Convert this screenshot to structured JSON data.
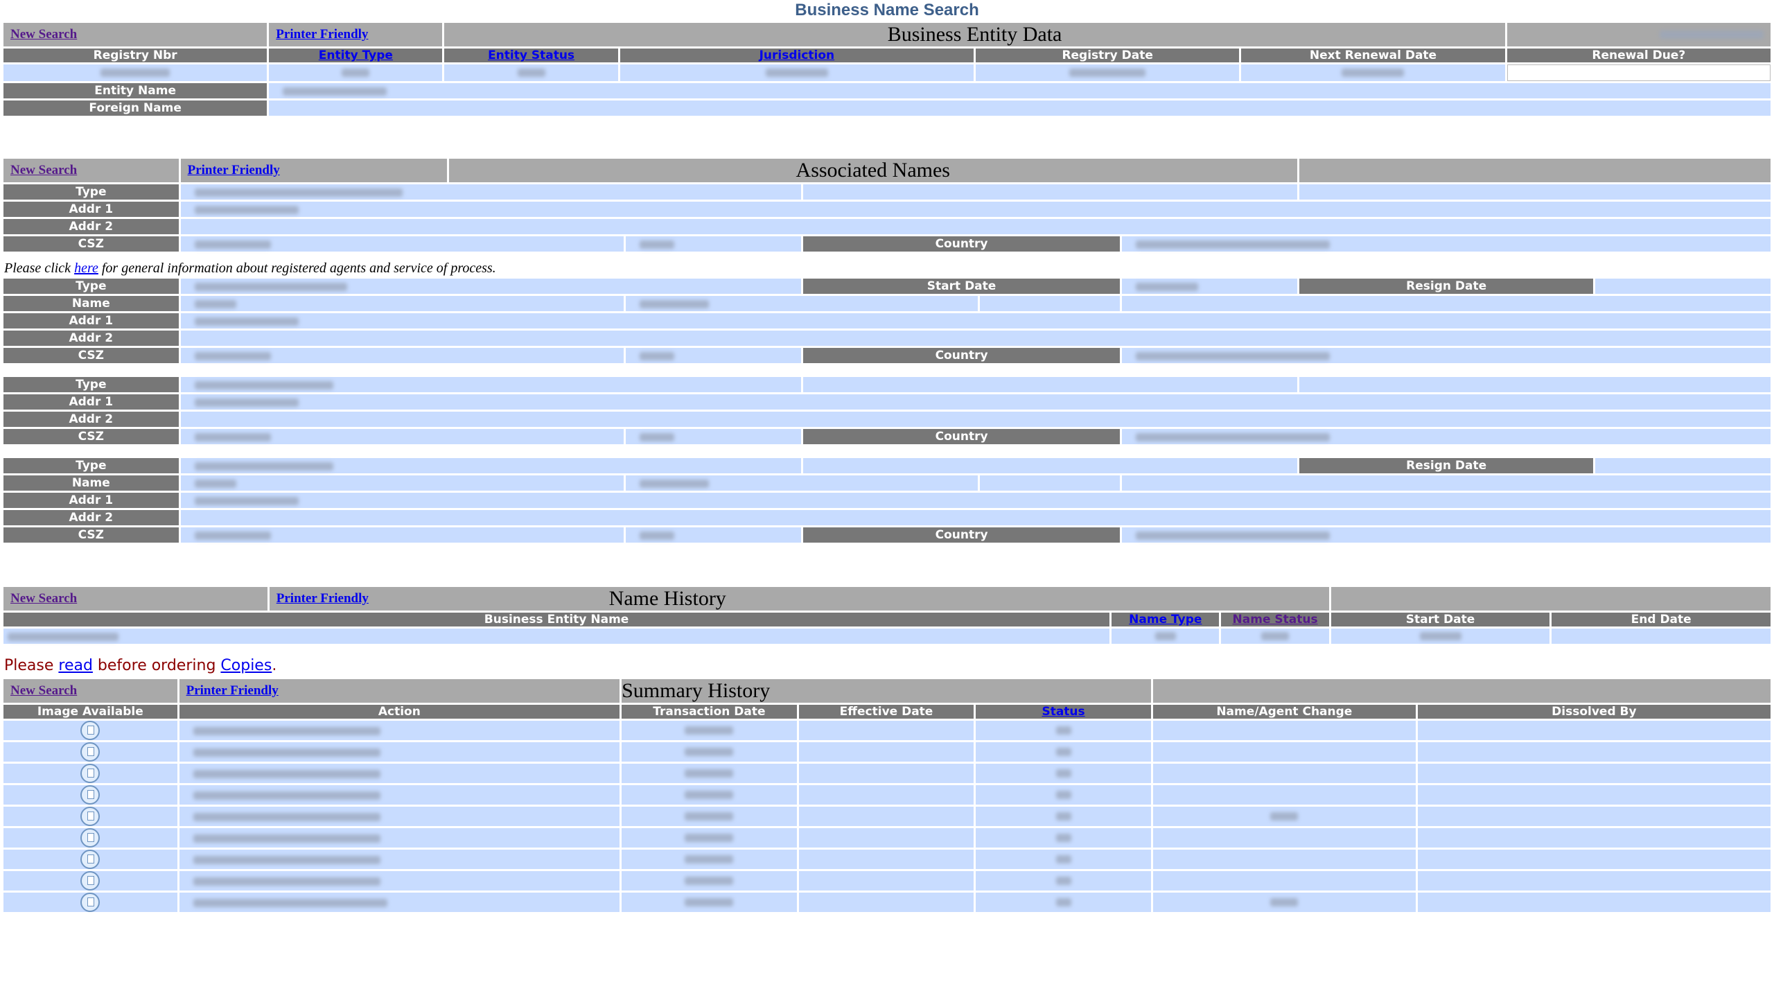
{
  "page_title": "Business Name Search",
  "nav": {
    "new_search": "New Search",
    "printer_friendly": "Printer Friendly"
  },
  "entity": {
    "title": "Business Entity Data",
    "columns": [
      "Registry Nbr",
      "Entity Type",
      "Entity Status",
      "Jurisdiction",
      "Registry Date",
      "Next Renewal Date",
      "Renewal Due?"
    ],
    "linked_columns": [
      "Entity Type",
      "Entity Status",
      "Jurisdiction"
    ],
    "entity_name_label": "Entity Name",
    "foreign_name_label": "Foreign Name"
  },
  "associated": {
    "title": "Associated Names",
    "labels": {
      "type": "Type",
      "name": "Name",
      "addr1": "Addr 1",
      "addr2": "Addr 2",
      "csz": "CSZ",
      "country": "Country",
      "start_date": "Start Date",
      "resign_date": "Resign Date"
    },
    "note_prefix": "Please click ",
    "note_link": "here",
    "note_suffix": " for general information about registered agents and service of process."
  },
  "name_history": {
    "title": "Name History",
    "columns": [
      "Business Entity Name",
      "Name Type",
      "Name Status",
      "Start Date",
      "End Date"
    ]
  },
  "copies_notice": {
    "prefix": "Please ",
    "read_link": "read",
    "middle": " before ordering ",
    "copies_link": "Copies",
    "suffix": "."
  },
  "summary": {
    "title": "Summary History",
    "columns": [
      "Image Available",
      "Action",
      "Transaction Date",
      "Effective Date",
      "Status",
      "Name/Agent Change",
      "Dissolved By"
    ],
    "row_count": 9,
    "icon": "document-icon"
  }
}
